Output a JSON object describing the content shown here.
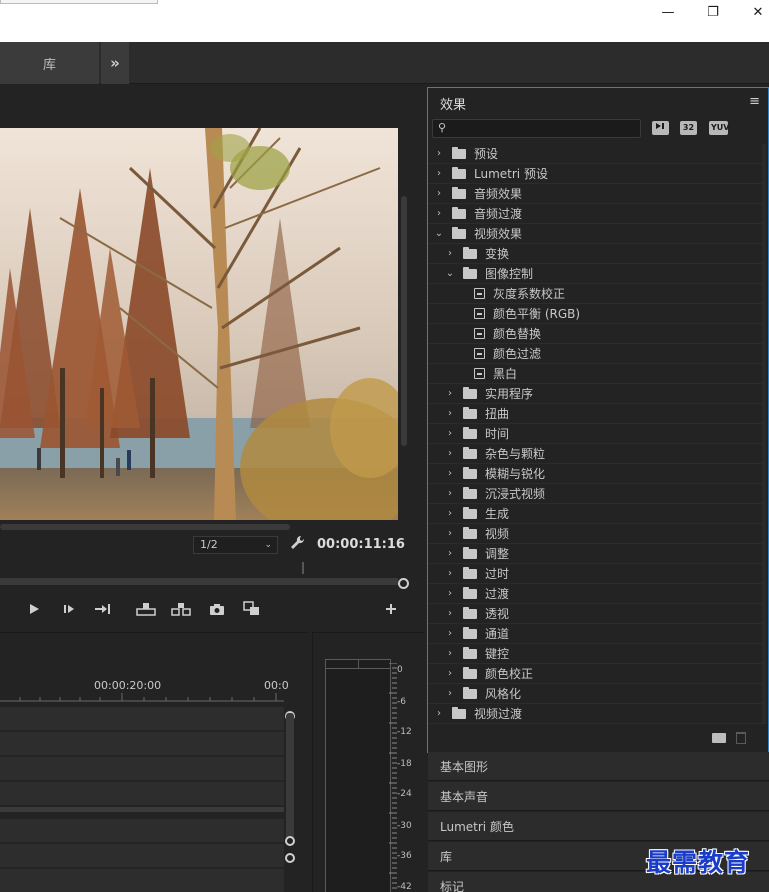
{
  "window": {
    "minimize_glyph": "—",
    "maximize_glyph": "❐",
    "close_glyph": "✕"
  },
  "workspace": {
    "tab_library": "库",
    "more_glyph": "»"
  },
  "monitor": {
    "zoom_value": "1/2",
    "timecode": "00:00:11:16"
  },
  "timeline": {
    "time_label_1": "00:00:20:00",
    "time_label_2": "00:0"
  },
  "meter": {
    "db_labels": [
      "0",
      "-6",
      "-12",
      "-18",
      "-24",
      "-30",
      "-36",
      "-42"
    ]
  },
  "effects": {
    "title": "效果",
    "menu_glyph": "≡",
    "badges": [
      "32",
      "YUV"
    ],
    "tree": [
      {
        "label": "预设",
        "level": 0,
        "state": "collapsed",
        "type": "preset-folder"
      },
      {
        "label": "Lumetri 预设",
        "level": 0,
        "state": "collapsed",
        "type": "preset-folder"
      },
      {
        "label": "音频效果",
        "level": 0,
        "state": "collapsed",
        "type": "folder"
      },
      {
        "label": "音频过渡",
        "level": 0,
        "state": "collapsed",
        "type": "folder"
      },
      {
        "label": "视频效果",
        "level": 0,
        "state": "expanded",
        "type": "folder"
      },
      {
        "label": "变换",
        "level": 1,
        "state": "collapsed",
        "type": "folder"
      },
      {
        "label": "图像控制",
        "level": 1,
        "state": "expanded",
        "type": "folder"
      },
      {
        "label": "灰度系数校正",
        "level": 2,
        "state": "leaf",
        "type": "effect"
      },
      {
        "label": "颜色平衡 (RGB)",
        "level": 2,
        "state": "leaf",
        "type": "effect"
      },
      {
        "label": "颜色替换",
        "level": 2,
        "state": "leaf",
        "type": "effect"
      },
      {
        "label": "颜色过滤",
        "level": 2,
        "state": "leaf",
        "type": "effect"
      },
      {
        "label": "黑白",
        "level": 2,
        "state": "leaf",
        "type": "effect"
      },
      {
        "label": "实用程序",
        "level": 1,
        "state": "collapsed",
        "type": "folder"
      },
      {
        "label": "扭曲",
        "level": 1,
        "state": "collapsed",
        "type": "folder"
      },
      {
        "label": "时间",
        "level": 1,
        "state": "collapsed",
        "type": "folder"
      },
      {
        "label": "杂色与颗粒",
        "level": 1,
        "state": "collapsed",
        "type": "folder"
      },
      {
        "label": "模糊与锐化",
        "level": 1,
        "state": "collapsed",
        "type": "folder"
      },
      {
        "label": "沉浸式视频",
        "level": 1,
        "state": "collapsed",
        "type": "folder"
      },
      {
        "label": "生成",
        "level": 1,
        "state": "collapsed",
        "type": "folder"
      },
      {
        "label": "视频",
        "level": 1,
        "state": "collapsed",
        "type": "folder"
      },
      {
        "label": "调整",
        "level": 1,
        "state": "collapsed",
        "type": "folder"
      },
      {
        "label": "过时",
        "level": 1,
        "state": "collapsed",
        "type": "folder"
      },
      {
        "label": "过渡",
        "level": 1,
        "state": "collapsed",
        "type": "folder"
      },
      {
        "label": "透视",
        "level": 1,
        "state": "collapsed",
        "type": "folder"
      },
      {
        "label": "通道",
        "level": 1,
        "state": "collapsed",
        "type": "folder"
      },
      {
        "label": "键控",
        "level": 1,
        "state": "collapsed",
        "type": "folder"
      },
      {
        "label": "颜色校正",
        "level": 1,
        "state": "collapsed",
        "type": "folder"
      },
      {
        "label": "风格化",
        "level": 1,
        "state": "collapsed",
        "type": "folder"
      },
      {
        "label": "视频过渡",
        "level": 0,
        "state": "collapsed",
        "type": "folder"
      }
    ]
  },
  "panels": {
    "essential_graphics": "基本图形",
    "essential_sound": "基本声音",
    "lumetri_color": "Lumetri 颜色",
    "libraries": "库",
    "markers": "标记"
  },
  "watermark": "最需教育",
  "colors": {
    "accent_border": "#2f83c8",
    "panel_bg": "#232323",
    "watermark": "#1a3cc8"
  }
}
